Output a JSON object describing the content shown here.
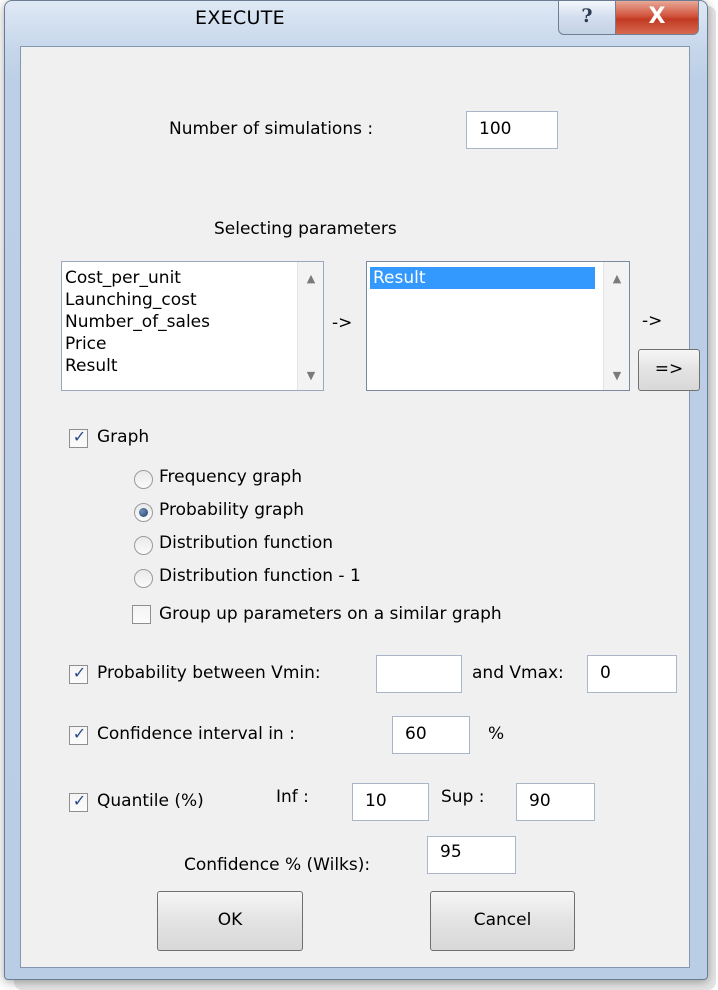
{
  "window": {
    "title": "EXECUTE",
    "help_glyph": "?",
    "close_glyph": "X"
  },
  "simulations": {
    "label": "Number of simulations :",
    "value": "100"
  },
  "parameters": {
    "heading": "Selecting parameters",
    "available": [
      "Cost_per_unit",
      "Launching_cost",
      "Number_of_sales",
      "Price",
      "Result"
    ],
    "selected": [
      "Result"
    ],
    "arrow_between": "->",
    "arrow_right": "->",
    "move_button": "=>"
  },
  "graph": {
    "label": "Graph",
    "checked": true,
    "options": [
      "Frequency graph",
      "Probability graph",
      "Distribution function",
      "Distribution function - 1"
    ],
    "selected_option": "Probability graph",
    "group_label": "Group up parameters on a similar graph",
    "group_checked": false
  },
  "probability": {
    "label": "Probability between Vmin:",
    "checked": true,
    "vmin": "",
    "and_label": "and Vmax:",
    "vmax": "0"
  },
  "confidence": {
    "label": "Confidence interval in :",
    "checked": true,
    "value": "60",
    "unit": "%"
  },
  "quantile": {
    "label": "Quantile (%)",
    "checked": true,
    "inf_label": "Inf :",
    "inf": "10",
    "sup_label": "Sup :",
    "sup": "90"
  },
  "wilks": {
    "label": "Confidence % (Wilks):",
    "value": "95"
  },
  "buttons": {
    "ok": "OK",
    "cancel": "Cancel"
  },
  "icons": {
    "check": "checkmark-icon",
    "scroll_up": "scroll-up-arrow-icon",
    "scroll_down": "scroll-down-arrow-icon"
  }
}
